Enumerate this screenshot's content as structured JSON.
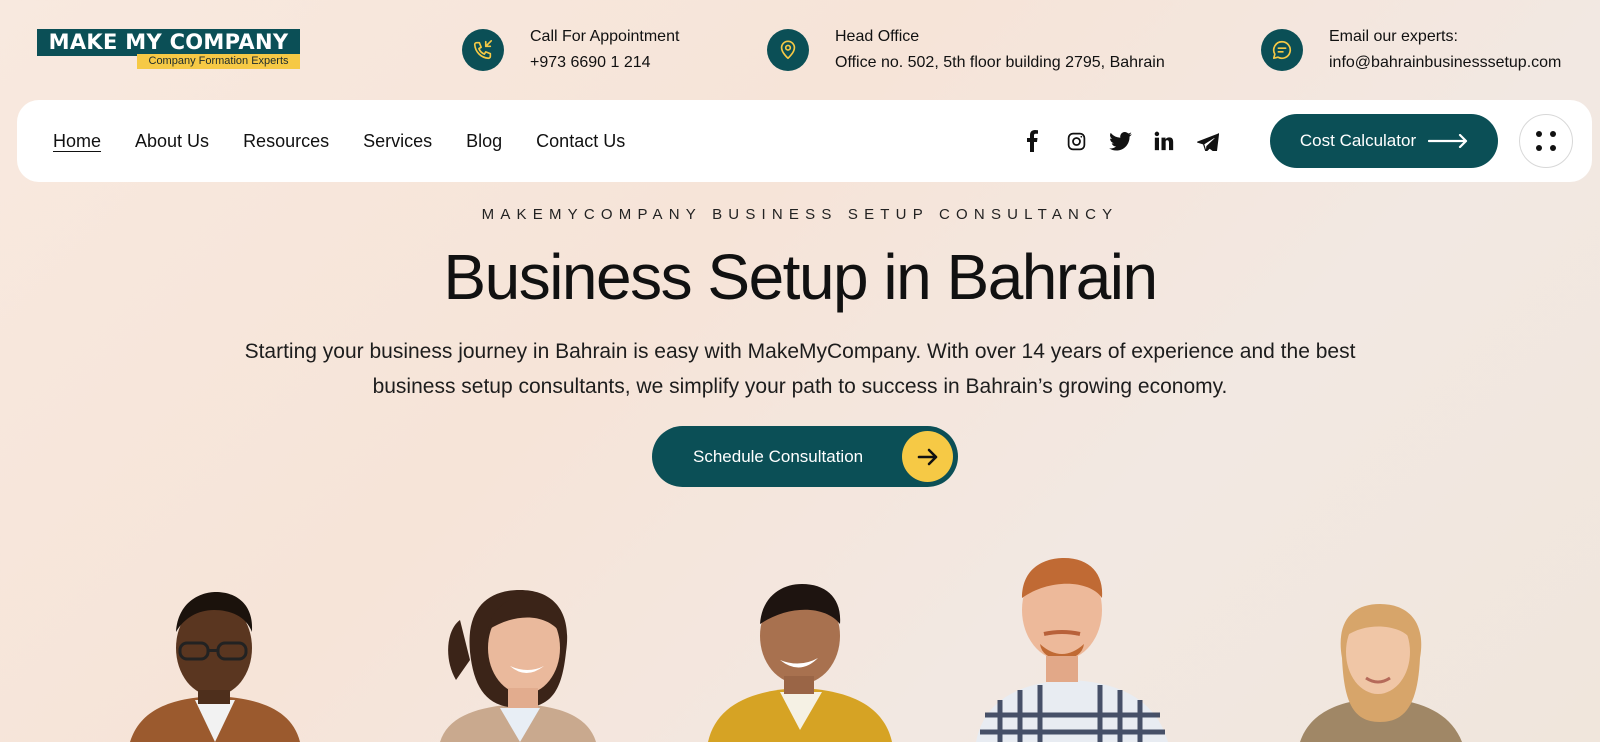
{
  "logo": {
    "name": "MAKE MY COMPANY",
    "tagline": "Company Formation Experts"
  },
  "topbar": {
    "call": {
      "label": "Call For Appointment",
      "value": "+973 6690 1 214"
    },
    "office": {
      "label": "Head Office",
      "value": "Office no. 502, 5th floor building 2795, Bahrain"
    },
    "email": {
      "label": "Email our experts:",
      "value": "info@bahrainbusinesssetup.com"
    }
  },
  "nav": {
    "items": [
      {
        "label": "Home"
      },
      {
        "label": "About Us"
      },
      {
        "label": "Resources"
      },
      {
        "label": "Services"
      },
      {
        "label": "Blog"
      },
      {
        "label": "Contact Us"
      }
    ],
    "active": "Home",
    "socials": [
      "facebook-icon",
      "instagram-icon",
      "twitter-icon",
      "linkedin-icon",
      "telegram-icon"
    ],
    "cost_button": "Cost Calculator",
    "menu_icon": "grid-dots-icon"
  },
  "hero": {
    "eyebrow": "MAKEMYCOMPANY BUSINESS SETUP CONSULTANCY",
    "title": "Business Setup in Bahrain",
    "description": "Starting your business journey in Bahrain is easy with MakeMyCompany. With over 14 years of experience and the best business setup consultants, we simplify your path to success in Bahrain’s growing economy.",
    "cta": "Schedule Consultation"
  },
  "colors": {
    "brand": "#0b4f56",
    "accent": "#f6c945",
    "background": "#f6e6dc"
  }
}
